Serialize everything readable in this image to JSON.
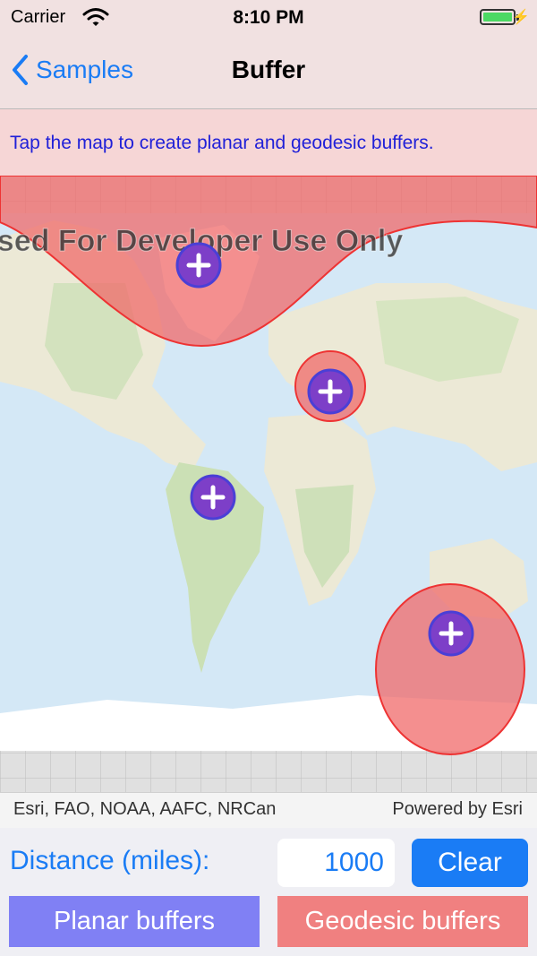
{
  "status_bar": {
    "carrier": "Carrier",
    "time": "8:10 PM"
  },
  "nav": {
    "back_label": "Samples",
    "title": "Buffer"
  },
  "instruction": "Tap the map to create planar and geodesic buffers.",
  "map": {
    "watermark": "Licensed For Developer Use Only",
    "point_count": 4
  },
  "attribution": {
    "sources": "Esri, FAO, NOAA, AAFC, NRCan",
    "powered_by": "Powered by Esri"
  },
  "controls": {
    "distance_label": "Distance (miles):",
    "distance_value": "1000",
    "clear_label": "Clear",
    "planar_label": "Planar buffers",
    "geodesic_label": "Geodesic buffers"
  },
  "colors": {
    "accent": "#1a7cf5",
    "planar": "#8080f4",
    "geodesic": "#f08080",
    "marker": "#7d3fc8"
  }
}
